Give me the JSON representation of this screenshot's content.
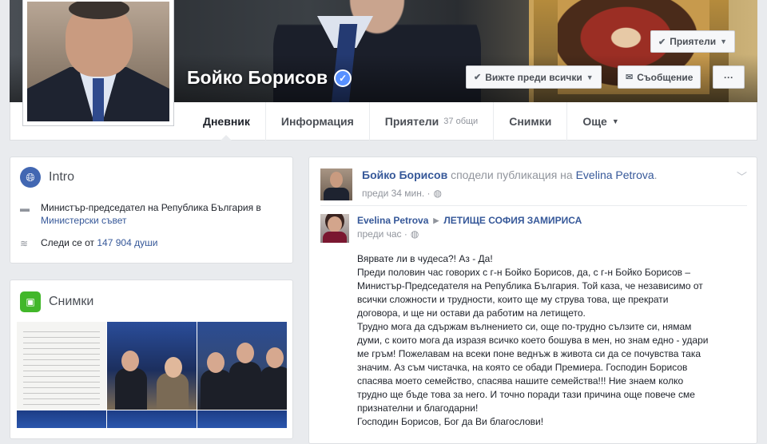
{
  "profile": {
    "name": "Бойко Борисов",
    "verified_icon": "verified-check-icon"
  },
  "cover_buttons": {
    "friends": "Приятели",
    "see_first": "Вижте преди всички",
    "message": "Съобщение",
    "more": "···"
  },
  "tabs": [
    {
      "label": "Дневник"
    },
    {
      "label": "Информация"
    },
    {
      "label": "Приятели",
      "sub": "37 общи"
    },
    {
      "label": "Снимки"
    },
    {
      "label": "Още"
    }
  ],
  "intro": {
    "title": "Intro",
    "job_prefix": "Министър-председател на Република България в",
    "job_link": "Министерски съвет",
    "followers_prefix": "Следи се от",
    "followers_link": "147 904 души"
  },
  "photos": {
    "title": "Снимки"
  },
  "post": {
    "author": "Бойко Борисов",
    "shared_text": "сподели публикация",
    "on": "на",
    "original_author": "Evelina Petrova",
    "dot": ".",
    "time": "преди 34 мин. ·",
    "shared": {
      "author": "Evelina Petrova",
      "target": "ЛЕТИЩЕ СОФИЯ ЗАМИРИСА",
      "time": "преди час ·"
    },
    "body_lines": [
      "Вярвате ли в чудеса?! Аз - Да!",
      "Преди половин час говорих с г-н Бойко Борисов, да, с г-н Бойко Борисов –",
      "Министър-Председателя на Република България. Той каза, че независимо от",
      "всички сложности и трудности, които ще му струва това, ще прекрати",
      "договора, и ще ни остави да работим на летището.",
      "Трудно мога да сдържам вълнението си, още по-трудно сълзите си, нямам",
      "думи, с които мога да изразя всичко което бошува в мен, но знам едно - удари",
      "ме гръм! Пожелавам на всеки поне веднъж в живота си да се почувства така",
      "значим. Аз съм чистачка, на която се обади Премиера. Господин Борисов",
      "спасява моето семейство, спасява нашите семейства!!! Ние знаем колко",
      "трудно ще бъде това за него. И точно поради тази причина още повече сме",
      "признателни и благодарни!",
      "Господин Борисов, Бог да Ви благослови!"
    ]
  }
}
